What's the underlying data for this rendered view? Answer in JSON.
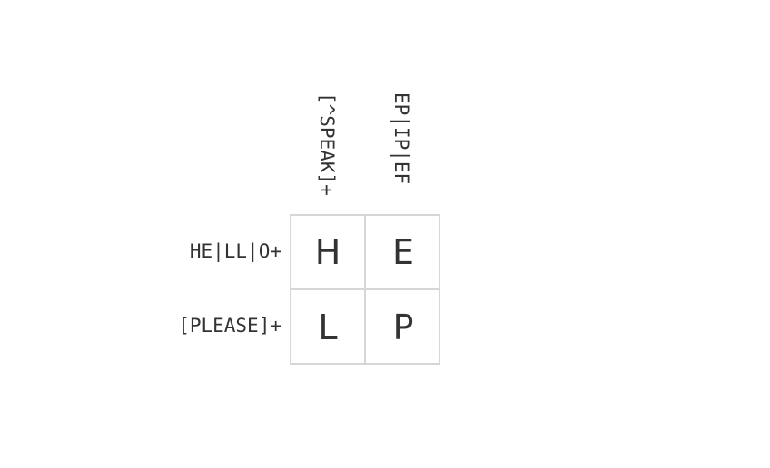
{
  "puzzle": {
    "column_clues": [
      "[^SPEAK]+",
      "EP|IP|EF"
    ],
    "row_clues": [
      "HE|LL|O+",
      "[PLEASE]+"
    ],
    "cells": [
      [
        "H",
        "E"
      ],
      [
        "L",
        "P"
      ]
    ]
  },
  "colors": {
    "text": "#333333",
    "grid_border": "#d6d6d6",
    "header_divider": "#e6e6e6"
  }
}
